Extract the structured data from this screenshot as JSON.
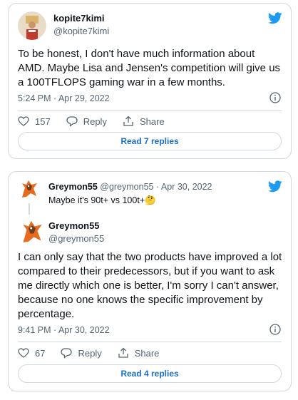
{
  "tweet1": {
    "name": "kopite7kimi",
    "handle": "@kopite7kimi",
    "text": "To be honest, I don't have much information about AMD. Maybe Lisa and Jensen's competition will give us a 100TFLOPS gaming war in a few months.",
    "timestamp": "5:24 PM · Apr 29, 2022",
    "likes": "157",
    "reply_label": "Reply",
    "share_label": "Share",
    "replies_button": "Read 7 replies"
  },
  "tweet2": {
    "quoted": {
      "name": "Greymon55",
      "handle": "@greymon55",
      "date": "· Apr 30, 2022",
      "text": "Maybe it's 90t+ vs 100t+🤔"
    },
    "name": "Greymon55",
    "handle": "@greymon55",
    "text": "I can only say that the two products have improved a lot compared to their predecessors, but if you want to ask me directly which one is better, I'm sorry I can't answer, because no one knows the specific improvement by percentage.",
    "timestamp": "9:41 PM · Apr 30, 2022",
    "likes": "67",
    "reply_label": "Reply",
    "share_label": "Share",
    "replies_button": "Read 4 replies"
  },
  "colors": {
    "twitter_blue": "#1d9bf0",
    "link_blue": "#1d70c7",
    "muted": "#536471",
    "border": "#cfd9de"
  },
  "icons": [
    "twitter-bird-icon",
    "heart-icon",
    "reply-bubble-icon",
    "share-icon",
    "info-icon"
  ]
}
